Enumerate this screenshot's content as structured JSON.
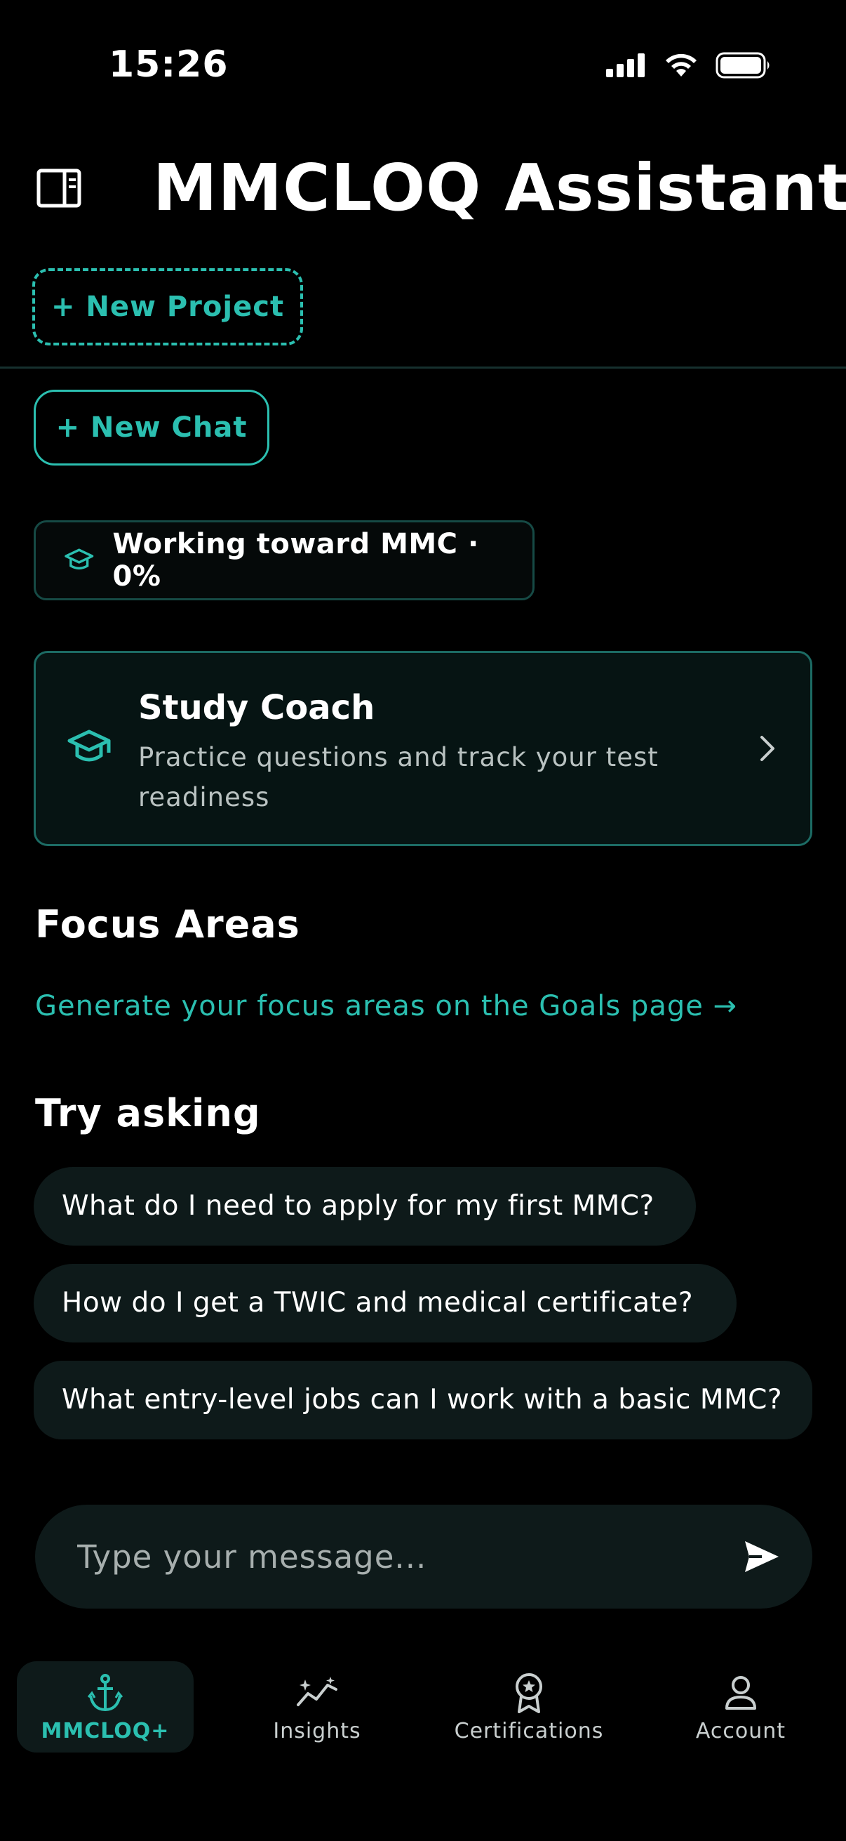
{
  "status_bar": {
    "time": "15:26",
    "icons": [
      "signal-icon",
      "wifi-icon",
      "battery-icon"
    ]
  },
  "header": {
    "title": "MMCLOQ Assistant",
    "sidebar_icon": "sidebar-toggle-icon"
  },
  "actions": {
    "new_project_label": "+ New Project",
    "new_chat_label": "+ New Chat"
  },
  "progress": {
    "label": "Working toward MMC · 0%",
    "percent": 0,
    "icon": "graduation-cap-icon"
  },
  "study_coach": {
    "title": "Study Coach",
    "description": "Practice questions and track your test readiness",
    "icon": "graduation-cap-icon"
  },
  "focus_areas": {
    "title": "Focus Areas",
    "link_text": "Generate your focus areas on the Goals page →"
  },
  "try_asking": {
    "title": "Try asking",
    "suggestions": [
      "What do I need to apply for my first MMC?",
      "How do I get a TWIC and medical certificate?",
      "What entry-level jobs can I work with a basic MMC?"
    ]
  },
  "composer": {
    "placeholder": "Type your message...",
    "send_icon": "send-icon"
  },
  "bottom_nav": {
    "items": [
      {
        "label": "MMCLOQ+",
        "icon": "anchor-icon",
        "active": true
      },
      {
        "label": "Insights",
        "icon": "sparkle-trend-icon",
        "active": false
      },
      {
        "label": "Certifications",
        "icon": "award-ribbon-icon",
        "active": false
      },
      {
        "label": "Account",
        "icon": "person-icon",
        "active": false
      }
    ]
  },
  "colors": {
    "accent": "#2bbfb0",
    "background": "#000000",
    "surface": "#0e1a1a"
  }
}
